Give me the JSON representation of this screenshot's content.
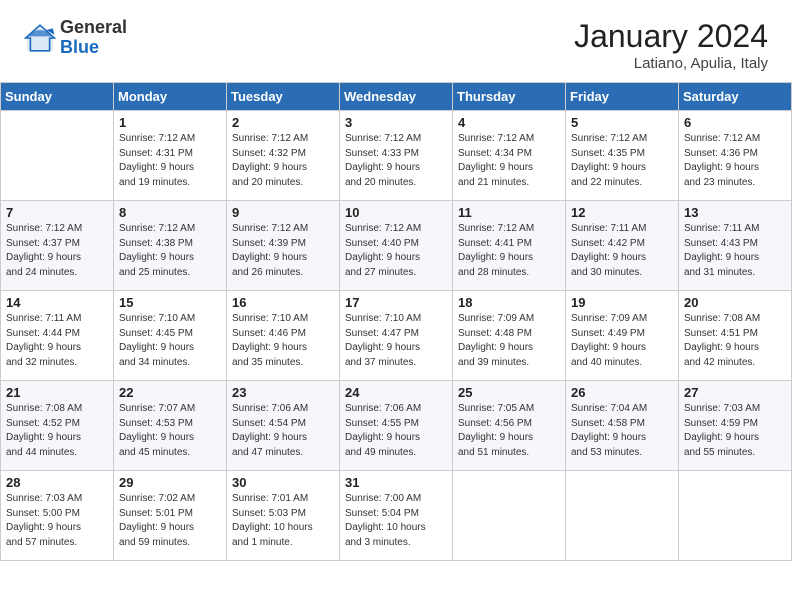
{
  "logo": {
    "general": "General",
    "blue": "Blue"
  },
  "header": {
    "month": "January 2024",
    "location": "Latiano, Apulia, Italy"
  },
  "weekdays": [
    "Sunday",
    "Monday",
    "Tuesday",
    "Wednesday",
    "Thursday",
    "Friday",
    "Saturday"
  ],
  "weeks": [
    [
      {
        "day": "",
        "info": ""
      },
      {
        "day": "1",
        "info": "Sunrise: 7:12 AM\nSunset: 4:31 PM\nDaylight: 9 hours\nand 19 minutes."
      },
      {
        "day": "2",
        "info": "Sunrise: 7:12 AM\nSunset: 4:32 PM\nDaylight: 9 hours\nand 20 minutes."
      },
      {
        "day": "3",
        "info": "Sunrise: 7:12 AM\nSunset: 4:33 PM\nDaylight: 9 hours\nand 20 minutes."
      },
      {
        "day": "4",
        "info": "Sunrise: 7:12 AM\nSunset: 4:34 PM\nDaylight: 9 hours\nand 21 minutes."
      },
      {
        "day": "5",
        "info": "Sunrise: 7:12 AM\nSunset: 4:35 PM\nDaylight: 9 hours\nand 22 minutes."
      },
      {
        "day": "6",
        "info": "Sunrise: 7:12 AM\nSunset: 4:36 PM\nDaylight: 9 hours\nand 23 minutes."
      }
    ],
    [
      {
        "day": "7",
        "info": "Sunrise: 7:12 AM\nSunset: 4:37 PM\nDaylight: 9 hours\nand 24 minutes."
      },
      {
        "day": "8",
        "info": "Sunrise: 7:12 AM\nSunset: 4:38 PM\nDaylight: 9 hours\nand 25 minutes."
      },
      {
        "day": "9",
        "info": "Sunrise: 7:12 AM\nSunset: 4:39 PM\nDaylight: 9 hours\nand 26 minutes."
      },
      {
        "day": "10",
        "info": "Sunrise: 7:12 AM\nSunset: 4:40 PM\nDaylight: 9 hours\nand 27 minutes."
      },
      {
        "day": "11",
        "info": "Sunrise: 7:12 AM\nSunset: 4:41 PM\nDaylight: 9 hours\nand 28 minutes."
      },
      {
        "day": "12",
        "info": "Sunrise: 7:11 AM\nSunset: 4:42 PM\nDaylight: 9 hours\nand 30 minutes."
      },
      {
        "day": "13",
        "info": "Sunrise: 7:11 AM\nSunset: 4:43 PM\nDaylight: 9 hours\nand 31 minutes."
      }
    ],
    [
      {
        "day": "14",
        "info": "Sunrise: 7:11 AM\nSunset: 4:44 PM\nDaylight: 9 hours\nand 32 minutes."
      },
      {
        "day": "15",
        "info": "Sunrise: 7:10 AM\nSunset: 4:45 PM\nDaylight: 9 hours\nand 34 minutes."
      },
      {
        "day": "16",
        "info": "Sunrise: 7:10 AM\nSunset: 4:46 PM\nDaylight: 9 hours\nand 35 minutes."
      },
      {
        "day": "17",
        "info": "Sunrise: 7:10 AM\nSunset: 4:47 PM\nDaylight: 9 hours\nand 37 minutes."
      },
      {
        "day": "18",
        "info": "Sunrise: 7:09 AM\nSunset: 4:48 PM\nDaylight: 9 hours\nand 39 minutes."
      },
      {
        "day": "19",
        "info": "Sunrise: 7:09 AM\nSunset: 4:49 PM\nDaylight: 9 hours\nand 40 minutes."
      },
      {
        "day": "20",
        "info": "Sunrise: 7:08 AM\nSunset: 4:51 PM\nDaylight: 9 hours\nand 42 minutes."
      }
    ],
    [
      {
        "day": "21",
        "info": "Sunrise: 7:08 AM\nSunset: 4:52 PM\nDaylight: 9 hours\nand 44 minutes."
      },
      {
        "day": "22",
        "info": "Sunrise: 7:07 AM\nSunset: 4:53 PM\nDaylight: 9 hours\nand 45 minutes."
      },
      {
        "day": "23",
        "info": "Sunrise: 7:06 AM\nSunset: 4:54 PM\nDaylight: 9 hours\nand 47 minutes."
      },
      {
        "day": "24",
        "info": "Sunrise: 7:06 AM\nSunset: 4:55 PM\nDaylight: 9 hours\nand 49 minutes."
      },
      {
        "day": "25",
        "info": "Sunrise: 7:05 AM\nSunset: 4:56 PM\nDaylight: 9 hours\nand 51 minutes."
      },
      {
        "day": "26",
        "info": "Sunrise: 7:04 AM\nSunset: 4:58 PM\nDaylight: 9 hours\nand 53 minutes."
      },
      {
        "day": "27",
        "info": "Sunrise: 7:03 AM\nSunset: 4:59 PM\nDaylight: 9 hours\nand 55 minutes."
      }
    ],
    [
      {
        "day": "28",
        "info": "Sunrise: 7:03 AM\nSunset: 5:00 PM\nDaylight: 9 hours\nand 57 minutes."
      },
      {
        "day": "29",
        "info": "Sunrise: 7:02 AM\nSunset: 5:01 PM\nDaylight: 9 hours\nand 59 minutes."
      },
      {
        "day": "30",
        "info": "Sunrise: 7:01 AM\nSunset: 5:03 PM\nDaylight: 10 hours\nand 1 minute."
      },
      {
        "day": "31",
        "info": "Sunrise: 7:00 AM\nSunset: 5:04 PM\nDaylight: 10 hours\nand 3 minutes."
      },
      {
        "day": "",
        "info": ""
      },
      {
        "day": "",
        "info": ""
      },
      {
        "day": "",
        "info": ""
      }
    ]
  ]
}
